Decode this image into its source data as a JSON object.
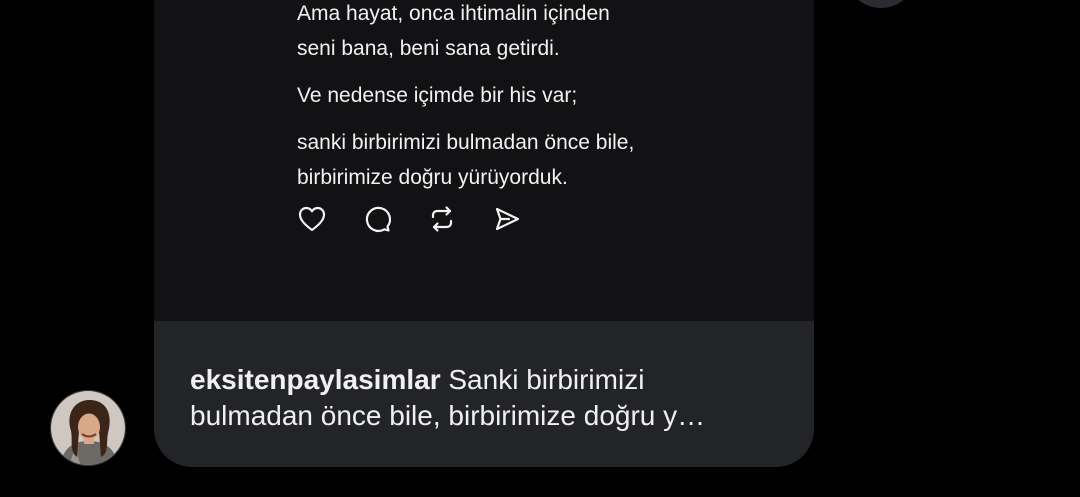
{
  "post": {
    "paragraphs": [
      [
        "Ama hayat, onca ihtimalin içinden",
        "seni bana, beni sana getirdi."
      ],
      [
        "Ve nedense içimde bir his var;"
      ],
      [
        "sanki birbirimizi bulmadan önce bile,",
        "birbirimize doğru yürüyorduk."
      ]
    ],
    "actions": [
      "heart-icon",
      "comment-icon",
      "repost-icon",
      "send-icon"
    ]
  },
  "caption": {
    "username": "eksitenpaylasimlar",
    "text_line1": "Sanki birbirimizi",
    "text_line2": "bulmadan önce bile, birbirimize doğru y…"
  },
  "avatar": {
    "icon": "profile-photo"
  },
  "colors": {
    "background": "#000000",
    "post_background": "#121214",
    "caption_background": "#232428",
    "text": "#f2f2f2"
  }
}
